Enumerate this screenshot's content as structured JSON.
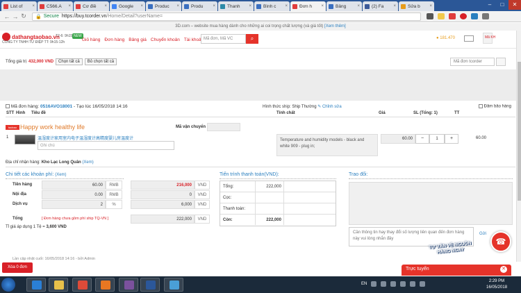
{
  "browser": {
    "tabs": [
      {
        "label": "List of",
        "color": "#e03c3c"
      },
      {
        "label": "C566.A",
        "color": "#e03c3c"
      },
      {
        "label": "Cơ điề",
        "color": "#e03c3c"
      },
      {
        "label": "Google",
        "color": "#4285f4"
      },
      {
        "label": "Produc",
        "color": "#3a6fc0"
      },
      {
        "label": "Produ",
        "color": "#3a6fc0"
      },
      {
        "label": "Thanh",
        "color": "#2c8aa8"
      },
      {
        "label": "Bình c",
        "color": "#3a6fc0"
      },
      {
        "label": "Đơn h",
        "color": "#e03c3c"
      },
      {
        "label": "Bảng",
        "color": "#3a6fc0"
      },
      {
        "label": "(2) Fa",
        "color": "#3b5998"
      },
      {
        "label": "Sửa b",
        "color": "#e89c1a"
      }
    ],
    "secure_label": "Secure",
    "url_host": "https://buy.tcorder.vn",
    "url_path": "/Home/Detail?userName="
  },
  "notice": {
    "text": "3D.com – website mua hàng dành cho những ai coi trọng chất lượng (và giá tốt)",
    "link": "[Xem thêm]"
  },
  "header": {
    "logo": "dathangtaobao.vn",
    "logo_sub": "CÔNG TY TNHH TƯ ĐIỆP TT: 9h15-12h",
    "hotline": "T2-6: 9h15-17h",
    "new_badge": "NEW",
    "menu": [
      "Giỏ hàng",
      "Đơn hàng",
      "Bảng giá",
      "Chuyển khoản",
      "Tài khoản GD"
    ],
    "search_placeholder": "Mã đơn, Mã VC",
    "wallet": "181.470",
    "user": "Mã KH"
  },
  "toolbar": {
    "total_label": "Tổng giá trị",
    "total_value": "432,000 VND",
    "select_all": "Chọn tất cả",
    "deselect_all": "Bỏ chọn tất cả",
    "filter_placeholder": "Mã đơn tcorder"
  },
  "order": {
    "code_label": "Mã đơn hàng:",
    "code": "0516AVO18001",
    "time": "- Tạo lúc 16/05/2018 14:16",
    "ship_label": "Hình thức ship: Ship Thường",
    "edit": "Chỉnh sửa",
    "insure": "Đảm bảo hàng",
    "columns": [
      "STT",
      "Hình",
      "Tiêu đề",
      "Tính chất",
      "Giá",
      "SL (Tổng: 1)",
      "TT"
    ],
    "store_logo": "taobao",
    "store": "Happy work healthy life",
    "ship_code_label": "Mã vận chuyển",
    "item": {
      "index": "1",
      "title": "温湿度计家用室内电子温湿度计高精度婴儿房温度计",
      "note_placeholder": "Ghi chú",
      "property": "Temperature and humidity models - black and white 909 - plug in;",
      "price": "60.00",
      "qty": "1",
      "total": "60.00"
    },
    "address_label": "Địa chỉ nhận hàng:",
    "address": "Kho Lạc Long Quân",
    "address_link": "(Xem)"
  },
  "payment": {
    "title": "Chi tiết các khoản phí:",
    "link": "(Xem)",
    "rows": [
      {
        "label": "Tiền hàng",
        "v1": "60.00",
        "u1": "RMB",
        "v2": "216,000",
        "u2": "VND"
      },
      {
        "label": "Nội địa",
        "v1": "0.00",
        "u1": "RMB",
        "v2": "0",
        "u2": "VND"
      },
      {
        "label": "Dịch vụ",
        "v1": "2",
        "u1": "%",
        "v2": "6,000",
        "u2": "VND"
      }
    ],
    "total_label": "Tổng",
    "total_note": "[ Đơn hàng chưa gồm phí ship TQ-VN ]",
    "total_value": "222,000",
    "total_unit": "VND",
    "rate_label": "Tỉ giá áp dụng 1 Tệ =",
    "rate_value": "3,600 VND"
  },
  "progress": {
    "title": "Tiến trình thanh toán(VND):",
    "rows": [
      {
        "label": "Tổng:",
        "value": "222,000",
        "bold": false
      },
      {
        "label": "Cọc:",
        "value": "",
        "bold": false
      },
      {
        "label": "Thanh toán:",
        "value": "",
        "bold": false
      },
      {
        "label": "Còn:",
        "value": "222,000",
        "bold": true
      }
    ]
  },
  "discussion": {
    "title": "Trao đổi:",
    "placeholder": "Cần thông tin hay thay đổi số lượng liên quan đến đơn hàng này vui lòng nhắn đây",
    "send": "Gửi"
  },
  "last_update": "Lần cập nhật cuối: 16/05/2018 14:16 - bởi Admin",
  "delete_button": "Xóa 0 đơn",
  "advice": "TƯ VẤN VỀ NGUỒN HÀNG NGAY",
  "online": "Trực tuyến",
  "taskbar": {
    "apps": [
      {
        "name": "ie",
        "color": "#2a7fd6"
      },
      {
        "name": "explorer",
        "color": "#e8c04a"
      },
      {
        "name": "chrome",
        "color": "#dd4b39"
      },
      {
        "name": "office",
        "color": "#e87722"
      },
      {
        "name": "viber",
        "color": "#7b519d"
      },
      {
        "name": "word",
        "color": "#2b579a"
      },
      {
        "name": "media",
        "color": "#4a9fd6"
      }
    ],
    "lang": "EN",
    "time": "2:29 PM",
    "date": "16/05/2018"
  }
}
